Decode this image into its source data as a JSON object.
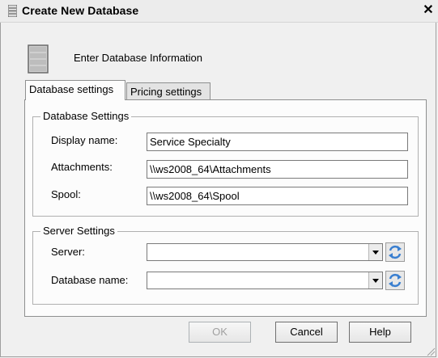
{
  "window": {
    "title": "Create New Database"
  },
  "header": {
    "text": "Enter Database Information"
  },
  "tabs": [
    {
      "label": "Database settings",
      "active": true
    },
    {
      "label": "Pricing settings",
      "active": false
    }
  ],
  "database_settings": {
    "legend": "Database Settings",
    "display_name": {
      "label": "Display name:",
      "value": "Service Specialty"
    },
    "attachments": {
      "label": "Attachments:",
      "value": "\\\\ws2008_64\\Attachments"
    },
    "spool": {
      "label": "Spool:",
      "value": "\\\\ws2008_64\\Spool"
    }
  },
  "server_settings": {
    "legend": "Server Settings",
    "server": {
      "label": "Server:",
      "value": ""
    },
    "database_name": {
      "label": "Database name:",
      "value": ""
    }
  },
  "buttons": {
    "ok": "OK",
    "cancel": "Cancel",
    "help": "Help"
  },
  "close_glyph": "✕",
  "colors": {
    "refresh_blue": "#3a7fd0",
    "panel": "#fcfcfc",
    "chrome": "#f0f0f0"
  }
}
